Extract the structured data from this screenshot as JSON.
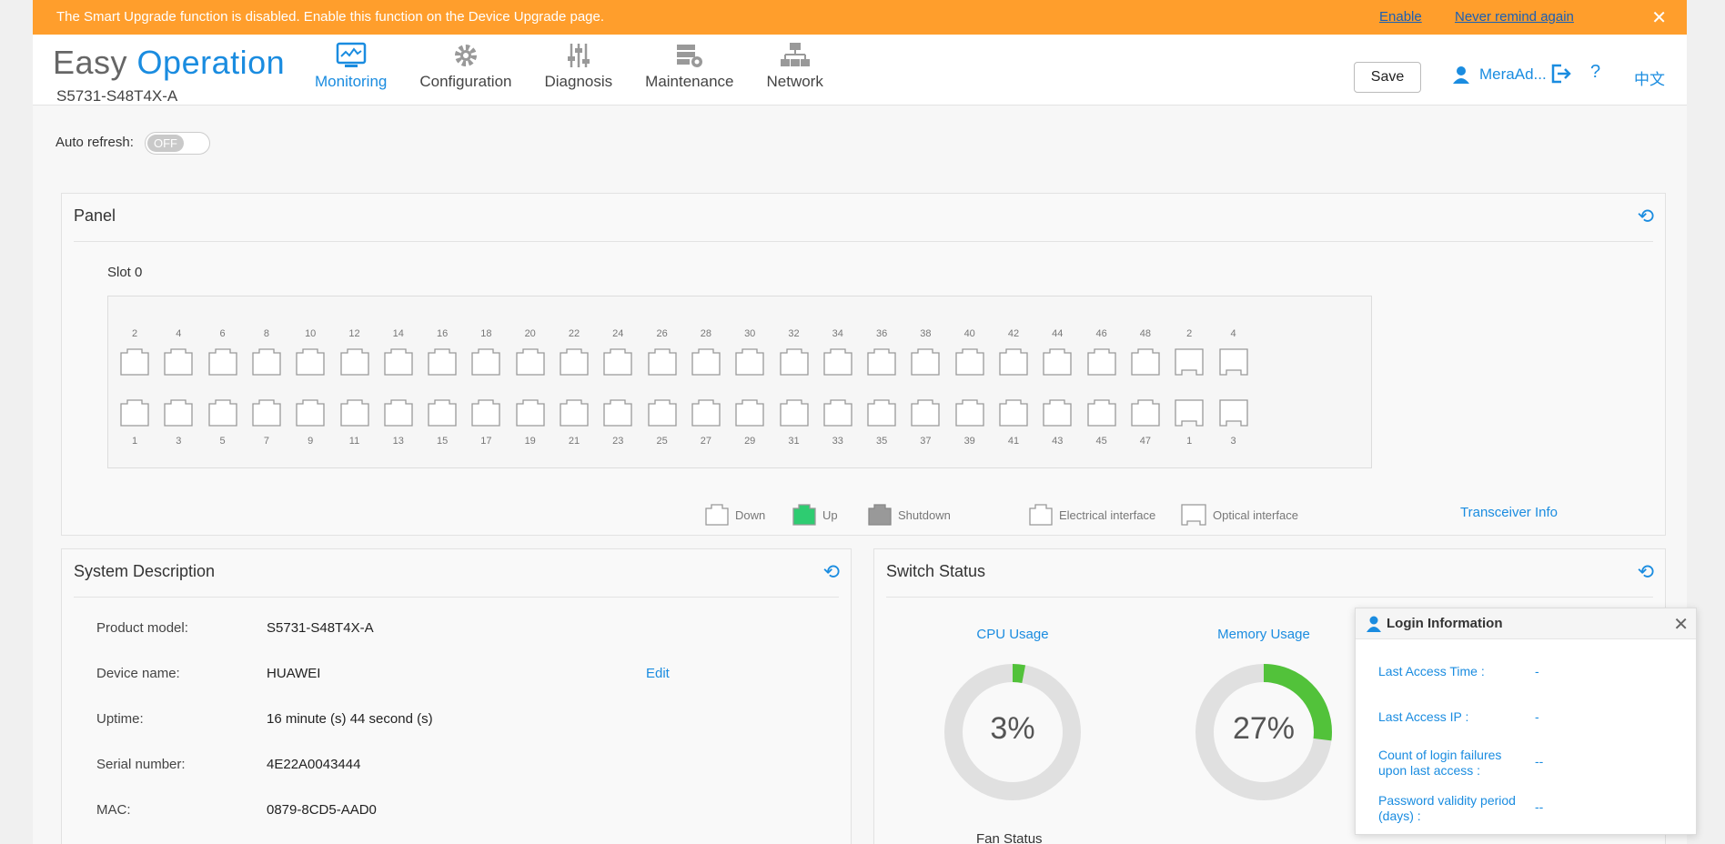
{
  "banner": {
    "message": "The Smart Upgrade function is disabled. Enable this function on the Device Upgrade page.",
    "enable_link": "Enable",
    "never_remind_link": "Never remind again",
    "close": "✕"
  },
  "header": {
    "brand_part1": "Easy ",
    "brand_part2": "Operation",
    "model": "S5731-S48T4X-A",
    "nav": [
      {
        "label": "Monitoring",
        "icon": "monitor-icon",
        "active": true
      },
      {
        "label": "Configuration",
        "icon": "gear-icon"
      },
      {
        "label": "Diagnosis",
        "icon": "sliders-icon"
      },
      {
        "label": "Maintenance",
        "icon": "maintenance-icon"
      },
      {
        "label": "Network",
        "icon": "network-topology-icon"
      }
    ],
    "save_label": "Save",
    "username": "MeraAd...",
    "help": "?",
    "language": "中文"
  },
  "auto_refresh": {
    "label": "Auto refresh:",
    "state": "OFF"
  },
  "panel": {
    "title": "Panel",
    "slot_label": "Slot 0",
    "top_row_numbers": [
      "2",
      "4",
      "6",
      "8",
      "10",
      "12",
      "14",
      "16",
      "18",
      "20",
      "22",
      "24",
      "26",
      "28",
      "30",
      "32",
      "34",
      "36",
      "38",
      "40",
      "42",
      "44",
      "46",
      "48",
      "2",
      "4"
    ],
    "bottom_row_numbers": [
      "1",
      "3",
      "5",
      "7",
      "9",
      "11",
      "13",
      "15",
      "17",
      "19",
      "21",
      "23",
      "25",
      "27",
      "29",
      "31",
      "33",
      "35",
      "37",
      "39",
      "41",
      "43",
      "45",
      "47",
      "1",
      "3"
    ],
    "legend": {
      "down": "Down",
      "up": "Up",
      "shutdown": "Shutdown",
      "electrical": "Electrical interface",
      "optical": "Optical interface"
    },
    "transceiver_link": "Transceiver Info",
    "colors": {
      "up": "#2ecc71",
      "shutdown": "#999999"
    }
  },
  "system_description": {
    "title": "System Description",
    "fields": [
      {
        "label": "Product model:",
        "value": "S5731-S48T4X-A"
      },
      {
        "label": "Device name:",
        "value": "HUAWEI"
      },
      {
        "label": "Uptime:",
        "value": "16 minute (s) 44 second (s)"
      },
      {
        "label": "Serial number:",
        "value": "4E22A0043444"
      },
      {
        "label": "MAC:",
        "value": "0879-8CD5-AAD0"
      }
    ],
    "edit_label": "Edit"
  },
  "switch_status": {
    "title": "Switch Status",
    "cpu": {
      "label": "CPU Usage",
      "value_text": "3%",
      "percent": 3
    },
    "memory": {
      "label": "Memory Usage",
      "value_text": "27%",
      "percent": 27
    },
    "fan_label": "Fan Status",
    "gauge_color": "#52c23a"
  },
  "login_info": {
    "title": "Login Information",
    "items": [
      {
        "label": "Last Access Time :",
        "value": "-"
      },
      {
        "label": "Last Access IP :",
        "value": "-"
      },
      {
        "label": "Count of login failures upon last access :",
        "value": "--"
      },
      {
        "label": "Password validity period (days) :",
        "value": "--"
      }
    ]
  }
}
